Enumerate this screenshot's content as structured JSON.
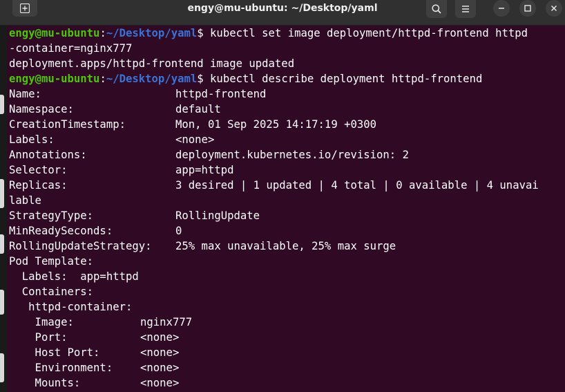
{
  "window": {
    "title": "engy@mu-ubuntu: ~/Desktop/yaml"
  },
  "icons": {
    "new_tab": "new-tab-icon",
    "search": "search-icon",
    "menu": "hamburger-menu-icon",
    "minimize": "minimize-icon",
    "maximize": "maximize-icon",
    "close": "close-icon"
  },
  "colors": {
    "terminal_bg": "#300a24",
    "prompt_user": "#4ec40c",
    "prompt_path": "#3a72d6",
    "text": "#ffffff",
    "titlebar": "#303030"
  },
  "prompt": {
    "user": "engy@mu-ubuntu",
    "colon": ":",
    "path": "~/Desktop/yaml",
    "symbol": "$"
  },
  "commands": {
    "cmd1_part1": " kubectl set image deployment/httpd-frontend httpd",
    "cmd1_part2": "-container=nginx777",
    "output1": "deployment.apps/httpd-frontend image updated",
    "cmd2": " kubectl describe deployment httpd-frontend"
  },
  "describe": {
    "name_k": "Name:",
    "name_v": "httpd-frontend",
    "namespace_k": "Namespace:",
    "namespace_v": "default",
    "created_k": "CreationTimestamp:",
    "created_v": "Mon, 01 Sep 2025 14:17:19 +0300",
    "labels_k": "Labels:",
    "labels_v": "<none>",
    "annotations_k": "Annotations:",
    "annotations_v": "deployment.kubernetes.io/revision: 2",
    "selector_k": "Selector:",
    "selector_v": "app=httpd",
    "replicas_k": "Replicas:",
    "replicas_v": "3 desired | 1 updated | 4 total | 0 available | 4 unavai",
    "replicas_wrap": "lable",
    "strategy_k": "StrategyType:",
    "strategy_v": "RollingUpdate",
    "minready_k": "MinReadySeconds:",
    "minready_v": "0",
    "rolling_k": "RollingUpdateStrategy:",
    "rolling_v": "25% max unavailable, 25% max surge",
    "podtemplate_k": "Pod Template:",
    "pt_labels": "  Labels:  app=httpd",
    "pt_containers": "  Containers:",
    "pt_container_name": "   httpd-container:",
    "image_k": "    Image:",
    "image_v": "nginx777",
    "port_k": "    Port:",
    "port_v": "<none>",
    "hostport_k": "    Host Port:",
    "hostport_v": "<none>",
    "env_k": "    Environment:",
    "env_v": "<none>",
    "mounts_k": "    Mounts:",
    "mounts_v": "<none>"
  }
}
